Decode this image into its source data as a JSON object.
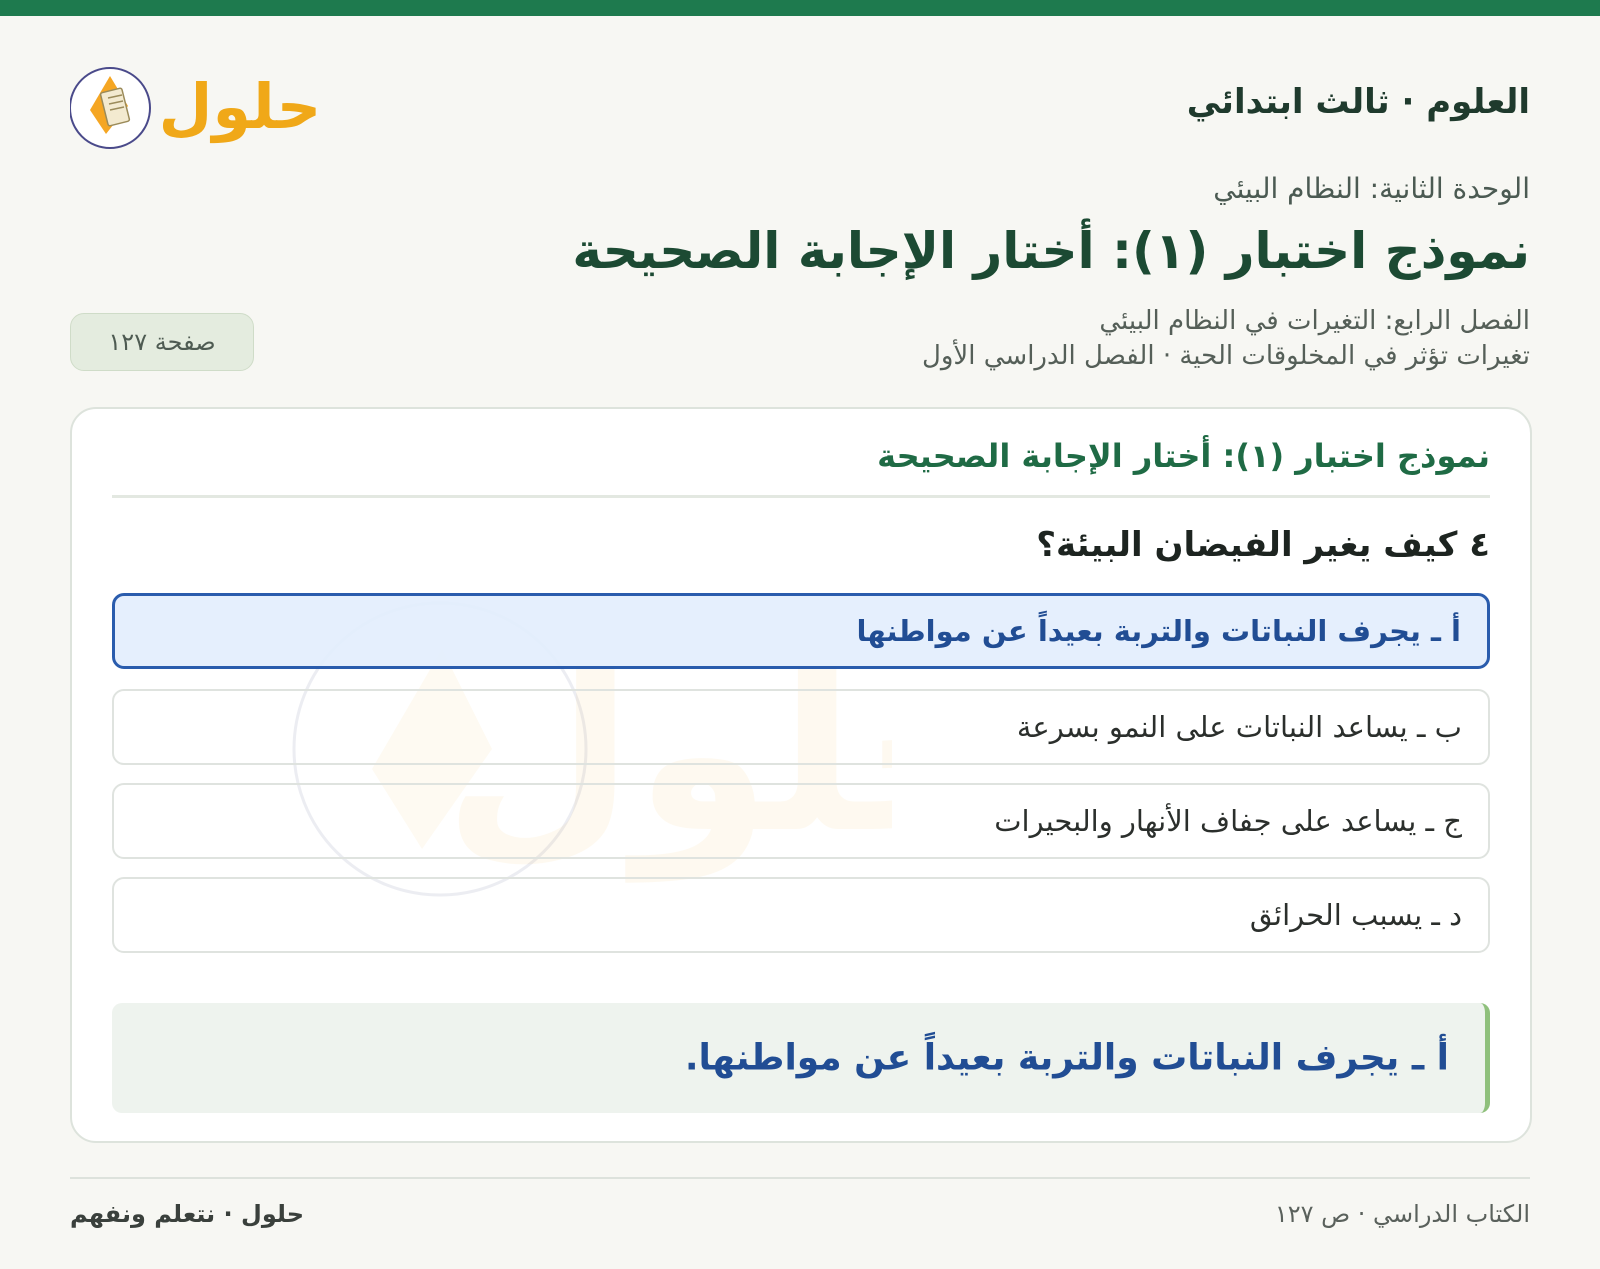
{
  "header": {
    "subject": "العلوم · ثالث ابتدائي",
    "logo_text": "حلول"
  },
  "unit": "الوحدة الثانية: النظام البيئي",
  "title": "نموذج اختبار (١): أختار الإجابة الصحيحة",
  "chapter": "الفصل الرابع: التغيرات في النظام البيئي",
  "lesson": "تغيرات تؤثر في المخلوقات الحية · الفصل الدراسي الأول",
  "page_badge": "صفحة ١٢٧",
  "card": {
    "title": "نموذج اختبار (١): أختار الإجابة الصحيحة",
    "question": "٤ كيف يغير الفيضان البيئة؟",
    "options": [
      {
        "label": "أ ـ يجرف النباتات والتربة بعيداً عن مواطنها",
        "selected": true
      },
      {
        "label": "ب ـ يساعد النباتات على النمو بسرعة",
        "selected": false
      },
      {
        "label": "ج ـ يساعد على جفاف الأنهار والبحيرات",
        "selected": false
      },
      {
        "label": "د ـ يسبب الحرائق",
        "selected": false
      }
    ],
    "answer": "أ ـ يجرف النباتات والتربة بعيداً عن مواطنها."
  },
  "footer": {
    "source": "الكتاب الدراسي · ص ١٢٧",
    "brand": "حلول · نتعلم ونفهم"
  },
  "colors": {
    "accent": "#1e7a4e",
    "selected_border": "#2a5cad",
    "answer_text": "#214d94",
    "answer_bar": "#8fc07c"
  }
}
